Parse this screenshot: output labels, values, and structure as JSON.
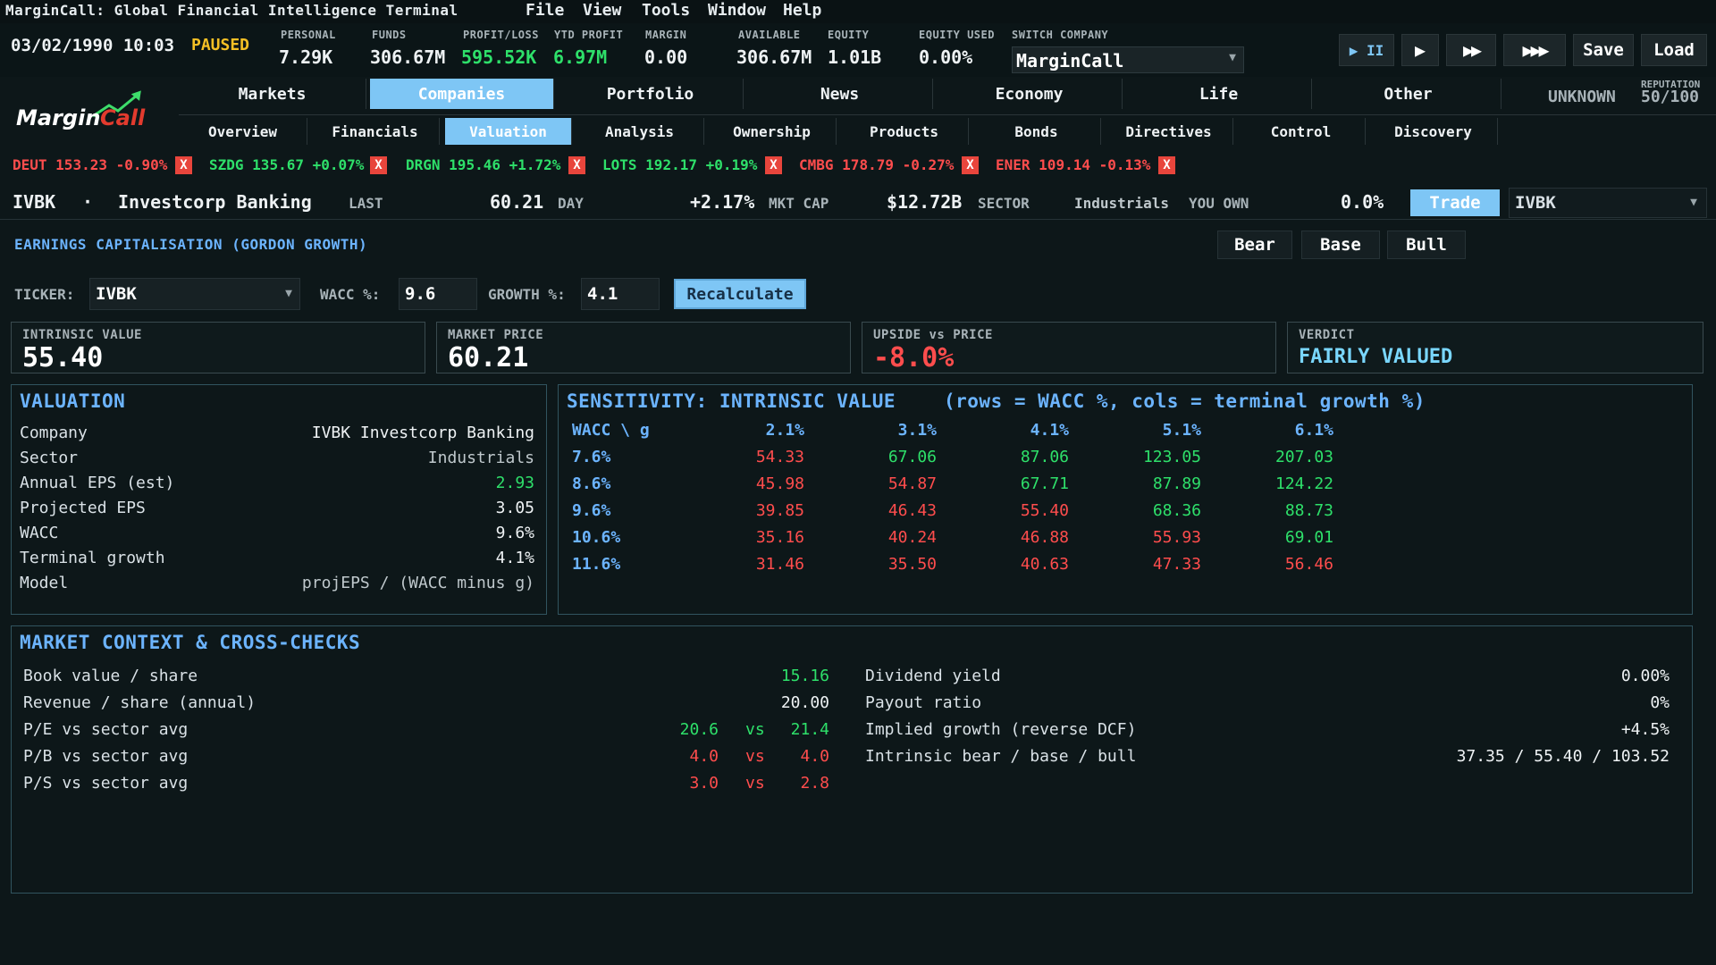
{
  "window": {
    "title": "MarginCall: Global Financial Intelligence Terminal",
    "menu": [
      "File",
      "View",
      "Tools",
      "Window",
      "Help"
    ]
  },
  "status": {
    "datetime": "03/02/1990 10:03",
    "state": "PAUSED",
    "personal": {
      "label": "PERSONAL",
      "value": "7.29K"
    },
    "funds": {
      "label": "FUNDS",
      "value": "306.67M"
    },
    "profit_loss": {
      "label": "PROFIT/LOSS",
      "value": "595.52K"
    },
    "ytd_profit": {
      "label": "YTD PROFIT",
      "value": "6.97M"
    },
    "margin": {
      "label": "MARGIN",
      "value": "0.00"
    },
    "available": {
      "label": "AVAILABLE",
      "value": "306.67M"
    },
    "equity": {
      "label": "EQUITY",
      "value": "1.01B"
    },
    "equity_used": {
      "label": "EQUITY USED",
      "value": "0.00%"
    },
    "switch_company": {
      "label": "SWITCH COMPANY",
      "value": "MarginCall"
    },
    "speed_controls": [
      "▶ II",
      "▶",
      "▶▶",
      "▶▶▶"
    ],
    "save_label": "Save",
    "load_label": "Load"
  },
  "logo_text": {
    "part1": "Margin",
    "part2": "Call"
  },
  "nav": {
    "main_tabs": [
      "Markets",
      "Companies",
      "Portfolio",
      "News",
      "Economy",
      "Life",
      "Other"
    ],
    "active_main": "Companies",
    "sub_tabs": [
      "Overview",
      "Financials",
      "Valuation",
      "Analysis",
      "Ownership",
      "Products",
      "Bonds",
      "Directives",
      "Control",
      "Discovery"
    ],
    "active_sub": "Valuation",
    "unknown": "UNKNOWN",
    "reputation_label": "REPUTATION",
    "reputation_value": "50/100"
  },
  "watchlist": [
    {
      "ticker": "DEUT",
      "price": "153.23",
      "change": "-0.90%",
      "dir": "down"
    },
    {
      "ticker": "SZDG",
      "price": "135.67",
      "change": "+0.07%",
      "dir": "up"
    },
    {
      "ticker": "DRGN",
      "price": "195.46",
      "change": "+1.72%",
      "dir": "up"
    },
    {
      "ticker": "LOTS",
      "price": "192.17",
      "change": "+0.19%",
      "dir": "up"
    },
    {
      "ticker": "CMBG",
      "price": "178.79",
      "change": "-0.27%",
      "dir": "down"
    },
    {
      "ticker": "ENER",
      "price": "109.14",
      "change": "-0.13%",
      "dir": "down"
    }
  ],
  "remove_label": "X",
  "stock": {
    "ticker": "IVBK",
    "sep": "·",
    "name": "Investcorp Banking",
    "last_label": "LAST",
    "last": "60.21",
    "day_label": "DAY",
    "day": "+2.17%",
    "mktcap_label": "MKT CAP",
    "mktcap": "$12.72B",
    "sector_label": "SECTOR",
    "sector": "Industrials",
    "own_label": "YOU OWN",
    "own": "0.0%",
    "trade_label": "Trade",
    "dropdown": "IVBK"
  },
  "section": {
    "title": "EARNINGS CAPITALISATION (GORDON GROWTH)",
    "scenarios": [
      "Bear",
      "Base",
      "Bull"
    ]
  },
  "inputs": {
    "ticker_label": "TICKER:",
    "ticker": "IVBK",
    "wacc_label": "WACC %:",
    "wacc": "9.6",
    "growth_label": "GROWTH %:",
    "growth": "4.1",
    "recalc_label": "Recalculate"
  },
  "kpis": [
    {
      "label": "INTRINSIC VALUE",
      "value": "55.40",
      "color": "#ffffff"
    },
    {
      "label": "MARKET PRICE",
      "value": "60.21",
      "color": "#ffffff"
    },
    {
      "label": "UPSIDE vs PRICE",
      "value": "-8.0%",
      "color": "#ff4d4d"
    },
    {
      "label": "VERDICT",
      "value": "FAIRLY VALUED",
      "color": "#7ad7ff"
    }
  ],
  "valuation": {
    "title": "VALUATION",
    "rows": [
      {
        "label": "Company",
        "value": "IVBK  Investcorp Banking",
        "color": "#eef2f4"
      },
      {
        "label": "Sector",
        "value": "Industrials",
        "color": "#bfc8cc"
      },
      {
        "label": "Annual EPS (est)",
        "value": "2.93",
        "color": "#2ee06a"
      },
      {
        "label": "Projected EPS",
        "value": "3.05",
        "color": "#eef2f4"
      },
      {
        "label": "WACC",
        "value": "9.6%",
        "color": "#eef2f4"
      },
      {
        "label": "Terminal growth",
        "value": "4.1%",
        "color": "#eef2f4"
      },
      {
        "label": "Model",
        "value": "projEPS / (WACC minus g)",
        "color": "#bfc8cc"
      }
    ]
  },
  "sensitivity": {
    "title": "SENSITIVITY: INTRINSIC VALUE",
    "subtitle": "(rows = WACC %, cols = terminal growth %)",
    "corner": "WACC \\ g",
    "cols": [
      "2.1%",
      "3.1%",
      "4.1%",
      "5.1%",
      "6.1%"
    ],
    "rows": [
      {
        "wacc": "7.6%",
        "values": [
          "54.33",
          "67.06",
          "87.06",
          "123.05",
          "207.03"
        ],
        "colors": [
          "r",
          "g",
          "g",
          "g",
          "g"
        ]
      },
      {
        "wacc": "8.6%",
        "values": [
          "45.98",
          "54.87",
          "67.71",
          "87.89",
          "124.22"
        ],
        "colors": [
          "r",
          "r",
          "g",
          "g",
          "g"
        ]
      },
      {
        "wacc": "9.6%",
        "values": [
          "39.85",
          "46.43",
          "55.40",
          "68.36",
          "88.73"
        ],
        "colors": [
          "r",
          "r",
          "r",
          "g",
          "g"
        ]
      },
      {
        "wacc": "10.6%",
        "values": [
          "35.16",
          "40.24",
          "46.88",
          "55.93",
          "69.01"
        ],
        "colors": [
          "r",
          "r",
          "r",
          "r",
          "g"
        ]
      },
      {
        "wacc": "11.6%",
        "values": [
          "31.46",
          "35.50",
          "40.63",
          "47.33",
          "56.46"
        ],
        "colors": [
          "r",
          "r",
          "r",
          "r",
          "r"
        ]
      }
    ]
  },
  "market_context": {
    "title": "MARKET CONTEXT & CROSS-CHECKS",
    "left": [
      {
        "label": "Book value / share",
        "value": "15.16",
        "color": "#2ee06a"
      },
      {
        "label": "Revenue / share (annual)",
        "value": "20.00",
        "color": "#eef2f4"
      },
      {
        "label": "P/E  vs sector avg",
        "a": "20.6",
        "vs": "vs",
        "b": "21.4",
        "color": "#2ee06a"
      },
      {
        "label": "P/B  vs sector avg",
        "a": "4.0",
        "vs": "vs",
        "b": "4.0",
        "color": "#ff4d4d"
      },
      {
        "label": "P/S  vs sector avg",
        "a": "3.0",
        "vs": "vs",
        "b": "2.8",
        "color": "#ff4d4d"
      }
    ],
    "right": [
      {
        "label": "Dividend yield",
        "value": "0.00%"
      },
      {
        "label": "Payout ratio",
        "value": "0%"
      },
      {
        "label": "Implied growth (reverse DCF)",
        "value": "+4.5%"
      },
      {
        "label": "Intrinsic  bear / base / bull",
        "value": "37.35  /  55.40  /  103.52"
      }
    ]
  }
}
